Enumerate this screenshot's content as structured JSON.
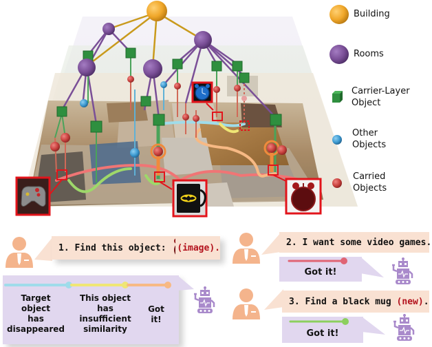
{
  "legend": {
    "items": [
      {
        "id": "building",
        "label": "Building",
        "color": "#f0a72a",
        "shape": "sphere-large"
      },
      {
        "id": "rooms",
        "label": "Rooms",
        "color": "#7a4f97",
        "shape": "sphere-large"
      },
      {
        "id": "carrier",
        "label": "Carrier-Layer Object",
        "label_lines": [
          "Carrier-Layer",
          "Object"
        ],
        "color": "#2f8f3f",
        "shape": "cube"
      },
      {
        "id": "other",
        "label": "Other Objects",
        "label_lines": [
          "Other",
          "Objects"
        ],
        "color": "#3d9ad1",
        "shape": "sphere-small"
      },
      {
        "id": "carried",
        "label": "Carried Objects",
        "label_lines": [
          "Carried",
          "Objects"
        ],
        "color": "#c9423f",
        "shape": "sphere-small"
      }
    ]
  },
  "colors": {
    "building": "#f0a72a",
    "room": "#7a4f97",
    "carrier": "#2f8f3f",
    "other": "#3d9ad1",
    "carried": "#c9423f",
    "highlight_box": "#e2141b",
    "user_bubble": "#f9e1d2",
    "robot_bubble": "#e1d7ef",
    "user_icon": "#f4b48c",
    "robot_icon": "#a98acb",
    "path_red": "#f07575",
    "path_green": "#9ed86a",
    "path_orange": "#f7b984",
    "path_cyan": "#9fdcea",
    "path_yellow": "#efe675"
  },
  "scene": {
    "callouts": [
      {
        "id": "alarm-clock-blue",
        "label": "blue alarm clock"
      },
      {
        "id": "game-controller",
        "label": "game controller"
      },
      {
        "id": "batman-mug",
        "label": "black batman mug"
      },
      {
        "id": "alarm-clock-red",
        "label": "red alarm clock"
      }
    ]
  },
  "dialog": {
    "q1": {
      "prefix": "1. Find this object:",
      "suffix": "(image)."
    },
    "q2": {
      "text": "2. I want some video games."
    },
    "q2_reply": {
      "text": "Got it!"
    },
    "q1_reply": {
      "steps": [
        {
          "lines": [
            "Target",
            "object",
            "has",
            "disappeared"
          ],
          "color": "#9fdcea"
        },
        {
          "lines": [
            "This object",
            "has",
            "insufficient",
            "similarity"
          ],
          "color": "#efe675"
        },
        {
          "lines": [
            "Got",
            "it!"
          ],
          "color": "#f7b984"
        }
      ]
    },
    "q3": {
      "prefix": "3. Find a black mug",
      "highlight": "(new)",
      "suffix": "."
    },
    "q3_reply": {
      "text": "Got it!"
    }
  }
}
